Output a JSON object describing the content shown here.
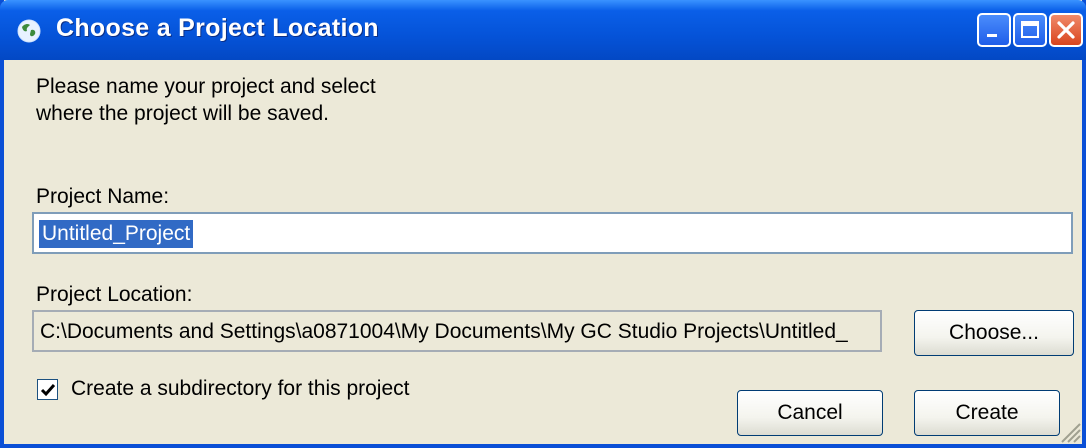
{
  "window": {
    "title": "Choose a Project Location",
    "title_icon": "globe-icon",
    "controls": {
      "minimize": "minimize-icon",
      "maximize": "maximize-icon",
      "close": "close-icon"
    }
  },
  "instructions": {
    "line1": "Please name your project and select",
    "line2": "where the project will be saved."
  },
  "project_name": {
    "label": "Project Name:",
    "value": "Untitled_Project"
  },
  "project_location": {
    "label": "Project Location:",
    "value": "C:\\Documents and Settings\\a0871004\\My Documents\\My GC Studio Projects\\Untitled_"
  },
  "choose_button": "Choose...",
  "subdirectory": {
    "label": "Create a subdirectory for this project",
    "checked": true
  },
  "buttons": {
    "cancel": "Cancel",
    "create": "Create"
  },
  "colors": {
    "titlebar": "#0553d8",
    "face": "#ece9d8",
    "selection": "#316ac5"
  }
}
